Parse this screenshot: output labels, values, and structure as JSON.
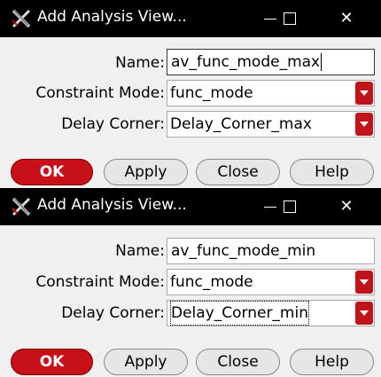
{
  "dialogs": [
    {
      "title": "Add Analysis View...",
      "name_label": "Name:",
      "name_value": "av_func_mode_max",
      "constraint_label": "Constraint Mode:",
      "constraint_value": "func_mode",
      "delay_label": "Delay Corner:",
      "delay_value": "Delay_Corner_max",
      "buttons": {
        "ok": "OK",
        "apply": "Apply",
        "close": "Close",
        "help": "Help"
      }
    },
    {
      "title": "Add Analysis View...",
      "name_label": "Name:",
      "name_value": "av_func_mode_min",
      "constraint_label": "Constraint Mode:",
      "constraint_value": "func_mode",
      "delay_label": "Delay Corner:",
      "delay_value": "Delay_Corner_min",
      "buttons": {
        "ok": "OK",
        "apply": "Apply",
        "close": "Close",
        "help": "Help"
      }
    }
  ],
  "window_controls": {
    "minimize": "—",
    "maximize": "☐",
    "close": "✕"
  },
  "colors": {
    "titlebar": "#000000",
    "accent_red": "#c8101a",
    "dialog_bg": "#f0f0f0"
  },
  "icons": {
    "app": "app-x-logo-icon",
    "dropdown": "chevron-down-icon"
  }
}
